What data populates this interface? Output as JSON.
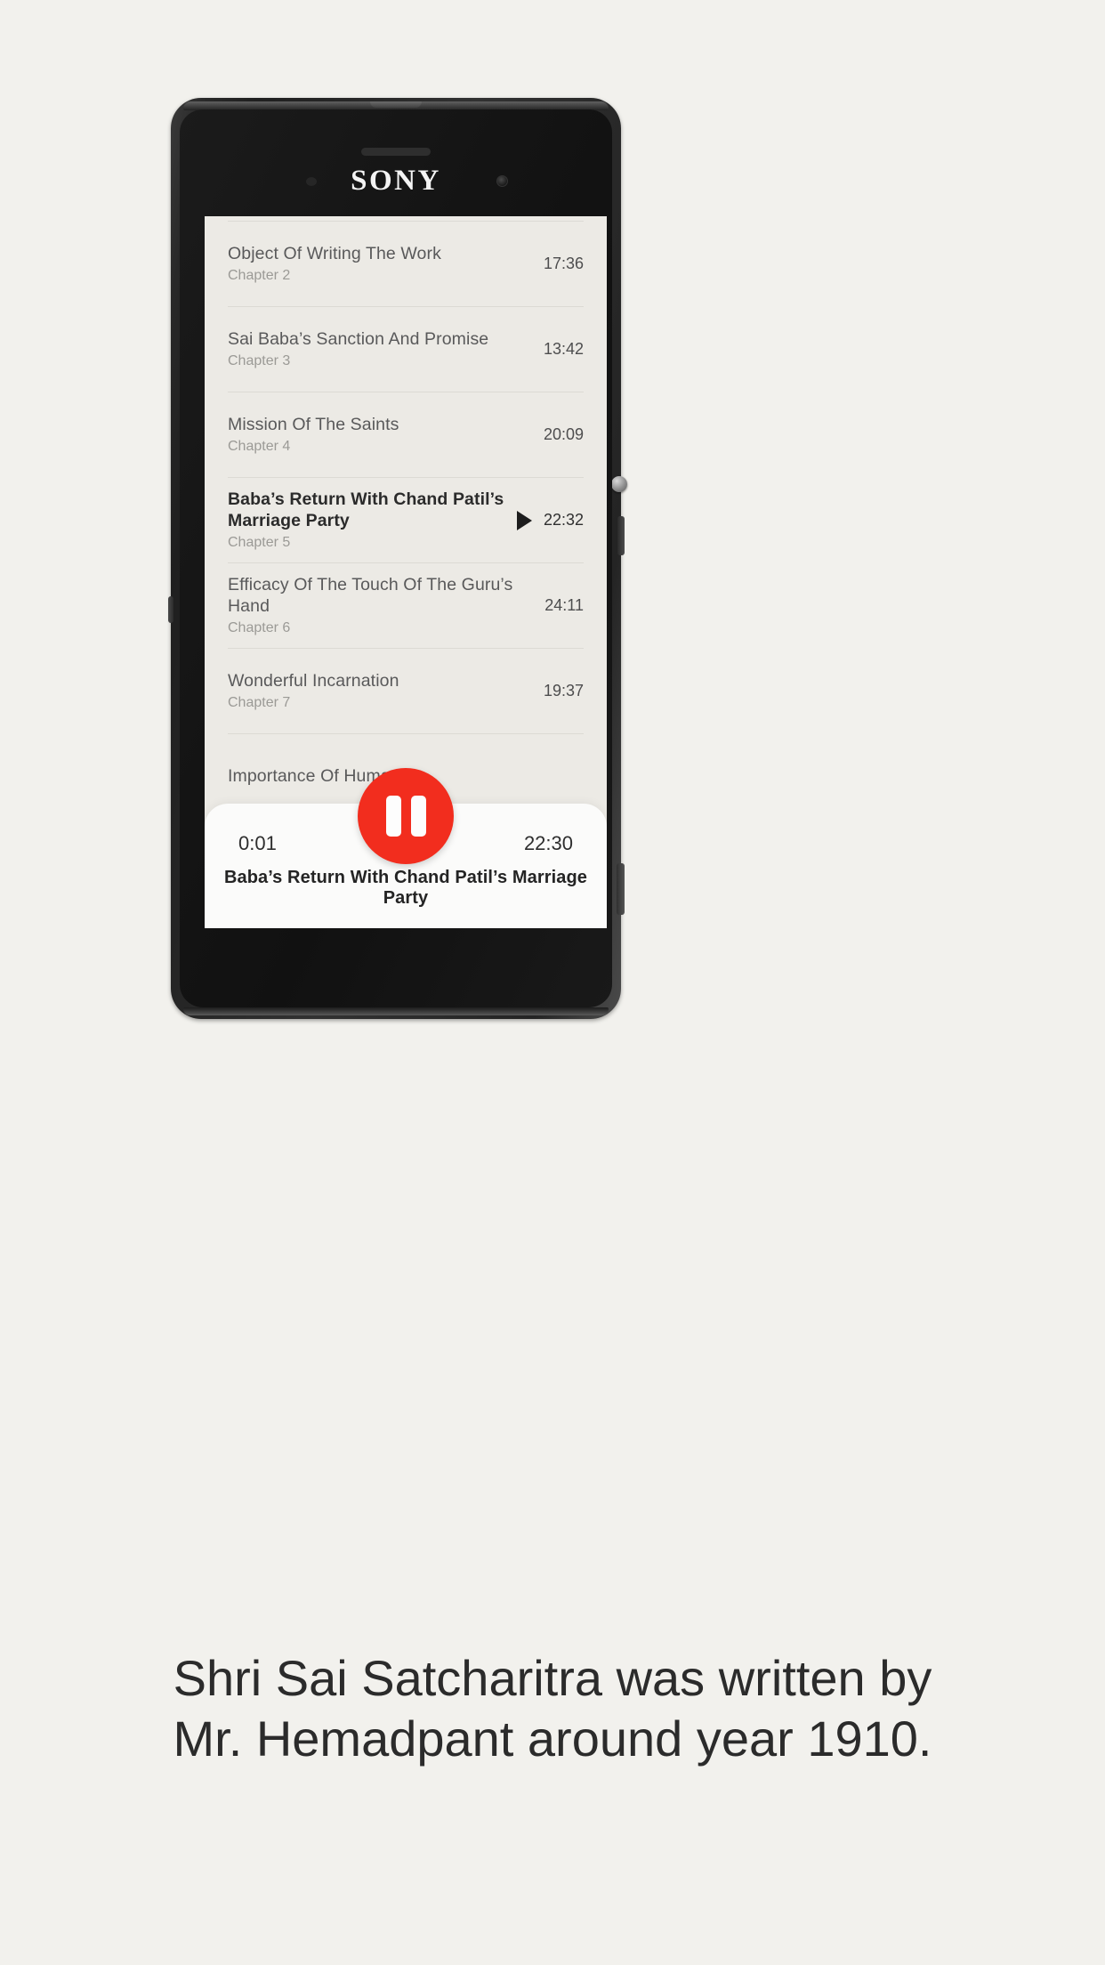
{
  "device": {
    "brand_logo": "SONY",
    "earpiece": "earpiece-speaker",
    "front_camera": "front-camera"
  },
  "screen": {
    "chapter_list": {
      "rows": [
        {
          "title": "Object Of Writing The Work",
          "subtitle": "Chapter 2",
          "duration": "17:36",
          "playing": false
        },
        {
          "title": "Sai Baba’s Sanction And Promise",
          "subtitle": "Chapter 3",
          "duration": "13:42",
          "playing": false
        },
        {
          "title": "Mission Of The Saints",
          "subtitle": "Chapter 4",
          "duration": "20:09",
          "playing": false
        },
        {
          "title": "Baba’s Return With Chand Patil’s Marriage Party",
          "subtitle": "Chapter 5",
          "duration": "22:32",
          "playing": true
        },
        {
          "title": "Efficacy Of The Touch Of The Guru’s Hand",
          "subtitle": "Chapter 6",
          "duration": "24:11",
          "playing": false
        },
        {
          "title": "Wonderful Incarnation",
          "subtitle": "Chapter 7",
          "duration": "19:37",
          "playing": false
        },
        {
          "title": "Importance Of Human B",
          "subtitle": "",
          "duration": "",
          "playing": false
        }
      ]
    },
    "player": {
      "elapsed": "0:01",
      "total": "22:30",
      "now_playing": "Baba’s Return With Chand Patil’s Marriage Party",
      "transport_state": "pause-icon",
      "accent_color": "#f22d1e"
    }
  },
  "caption": {
    "text": "Shri Sai Satcharitra was written by\nMr. Hemadpant around  year 1910."
  },
  "theme": {
    "page_background": "#f2f1ed",
    "screen_background": "#eceae5",
    "player_background": "#fbfbfa",
    "accent": "#f22d1e",
    "title_text": "#59595a",
    "sub_text": "#9b9a96"
  }
}
